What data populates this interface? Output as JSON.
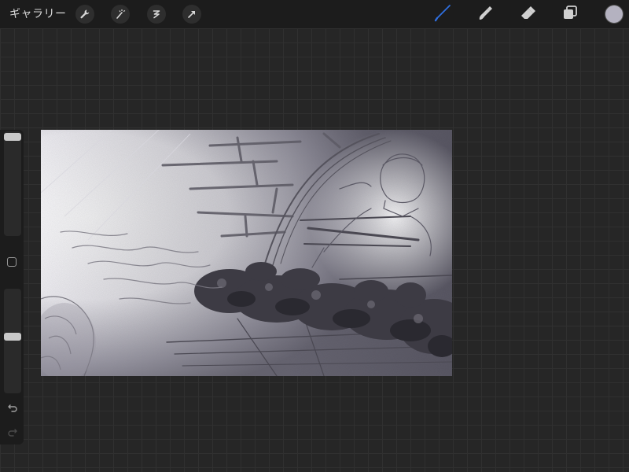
{
  "toolbar": {
    "gallery_label": "ギャラリー",
    "left_tools": [
      {
        "icon": "wrench-icon",
        "name": "actions"
      },
      {
        "icon": "magic-wand-icon",
        "name": "adjustments"
      },
      {
        "icon": "selection-s-icon",
        "name": "selection"
      },
      {
        "icon": "arrow-cursor-icon",
        "name": "transform"
      }
    ],
    "right_tools": [
      {
        "icon": "brush-icon",
        "name": "paint",
        "active": true
      },
      {
        "icon": "smudge-icon",
        "name": "smudge"
      },
      {
        "icon": "eraser-icon",
        "name": "eraser"
      },
      {
        "icon": "layers-icon",
        "name": "layers"
      }
    ],
    "current_color": "#b4b2c0",
    "active_tool_color": "#2f6fe0"
  },
  "sidebar": {
    "brush_size_level": 1.0,
    "opacity_level": 0.55,
    "modify_icon": "square-icon",
    "undo_icon": "undo-icon",
    "redo_icon": "redo-icon"
  },
  "canvas": {
    "description_icon": "sketch-artwork"
  }
}
